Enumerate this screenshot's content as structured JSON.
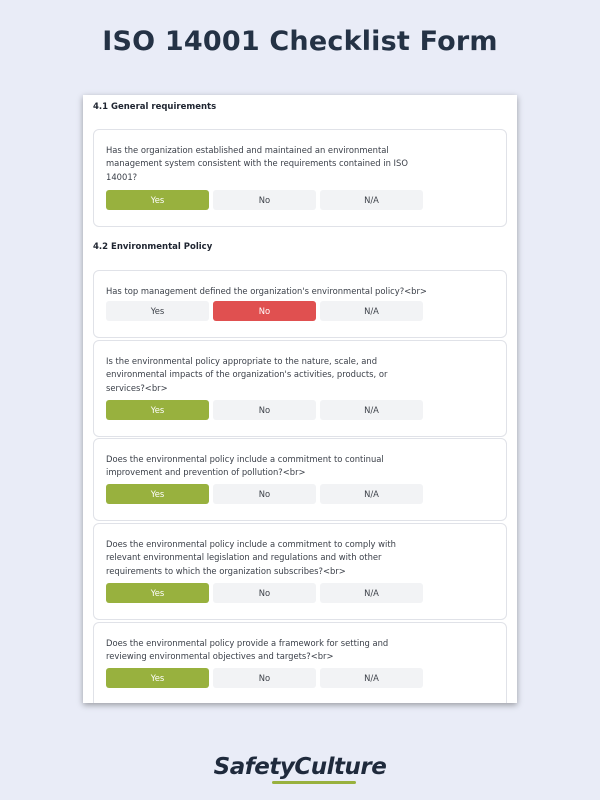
{
  "title": "ISO 14001 Checklist Form",
  "brand": "SafetyCulture",
  "sections": [
    {
      "heading": "4.1 General requirements",
      "questions": [
        {
          "text": "Has the organization established and maintained an environmental management system consistent with the requirements contained in ISO 14001?",
          "options": [
            "Yes",
            "No",
            "N/A"
          ],
          "selected": "Yes"
        }
      ]
    },
    {
      "heading": "4.2 Environmental Policy",
      "questions": [
        {
          "text": "Has top management defined the organization's environmental policy?<br>",
          "options": [
            "Yes",
            "No",
            "N/A"
          ],
          "selected": "No"
        },
        {
          "text": "Is the environmental policy appropriate to the nature, scale, and environmental impacts of the organization's activities, products, or services?<br>",
          "options": [
            "Yes",
            "No",
            "N/A"
          ],
          "selected": "Yes"
        },
        {
          "text": "Does the environmental policy include a commitment to continual improvement and prevention of pollution?<br>",
          "options": [
            "Yes",
            "No",
            "N/A"
          ],
          "selected": "Yes"
        },
        {
          "text": "Does the environmental policy include a commitment to comply with relevant environmental legislation and regulations and with other requirements to which the organization subscribes?<br>",
          "options": [
            "Yes",
            "No",
            "N/A"
          ],
          "selected": "Yes"
        },
        {
          "text": "Does the environmental policy provide a framework for setting and reviewing environmental objectives and targets?<br>",
          "options": [
            "Yes",
            "No",
            "N/A"
          ],
          "selected": "Yes"
        }
      ]
    }
  ],
  "colors": {
    "yes_selected": "#98b13e",
    "no_selected": "#e05050",
    "unselected": "#f2f3f5"
  }
}
